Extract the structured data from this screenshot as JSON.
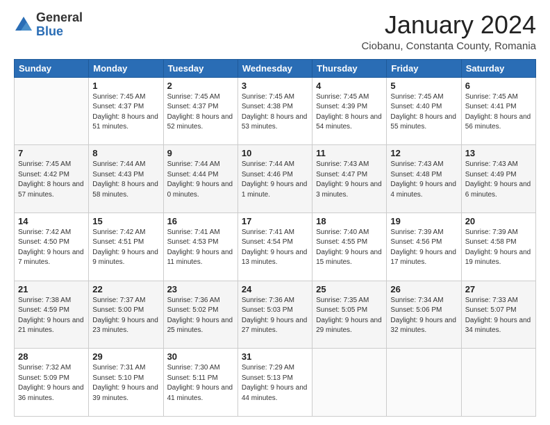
{
  "header": {
    "logo_general": "General",
    "logo_blue": "Blue",
    "month_title": "January 2024",
    "location": "Ciobanu, Constanta County, Romania"
  },
  "days_of_week": [
    "Sunday",
    "Monday",
    "Tuesday",
    "Wednesday",
    "Thursday",
    "Friday",
    "Saturday"
  ],
  "weeks": [
    [
      {
        "day": "",
        "sunrise": "",
        "sunset": "",
        "daylight": ""
      },
      {
        "day": "1",
        "sunrise": "Sunrise: 7:45 AM",
        "sunset": "Sunset: 4:37 PM",
        "daylight": "Daylight: 8 hours and 51 minutes."
      },
      {
        "day": "2",
        "sunrise": "Sunrise: 7:45 AM",
        "sunset": "Sunset: 4:37 PM",
        "daylight": "Daylight: 8 hours and 52 minutes."
      },
      {
        "day": "3",
        "sunrise": "Sunrise: 7:45 AM",
        "sunset": "Sunset: 4:38 PM",
        "daylight": "Daylight: 8 hours and 53 minutes."
      },
      {
        "day": "4",
        "sunrise": "Sunrise: 7:45 AM",
        "sunset": "Sunset: 4:39 PM",
        "daylight": "Daylight: 8 hours and 54 minutes."
      },
      {
        "day": "5",
        "sunrise": "Sunrise: 7:45 AM",
        "sunset": "Sunset: 4:40 PM",
        "daylight": "Daylight: 8 hours and 55 minutes."
      },
      {
        "day": "6",
        "sunrise": "Sunrise: 7:45 AM",
        "sunset": "Sunset: 4:41 PM",
        "daylight": "Daylight: 8 hours and 56 minutes."
      }
    ],
    [
      {
        "day": "7",
        "sunrise": "Sunrise: 7:45 AM",
        "sunset": "Sunset: 4:42 PM",
        "daylight": "Daylight: 8 hours and 57 minutes."
      },
      {
        "day": "8",
        "sunrise": "Sunrise: 7:44 AM",
        "sunset": "Sunset: 4:43 PM",
        "daylight": "Daylight: 8 hours and 58 minutes."
      },
      {
        "day": "9",
        "sunrise": "Sunrise: 7:44 AM",
        "sunset": "Sunset: 4:44 PM",
        "daylight": "Daylight: 9 hours and 0 minutes."
      },
      {
        "day": "10",
        "sunrise": "Sunrise: 7:44 AM",
        "sunset": "Sunset: 4:46 PM",
        "daylight": "Daylight: 9 hours and 1 minute."
      },
      {
        "day": "11",
        "sunrise": "Sunrise: 7:43 AM",
        "sunset": "Sunset: 4:47 PM",
        "daylight": "Daylight: 9 hours and 3 minutes."
      },
      {
        "day": "12",
        "sunrise": "Sunrise: 7:43 AM",
        "sunset": "Sunset: 4:48 PM",
        "daylight": "Daylight: 9 hours and 4 minutes."
      },
      {
        "day": "13",
        "sunrise": "Sunrise: 7:43 AM",
        "sunset": "Sunset: 4:49 PM",
        "daylight": "Daylight: 9 hours and 6 minutes."
      }
    ],
    [
      {
        "day": "14",
        "sunrise": "Sunrise: 7:42 AM",
        "sunset": "Sunset: 4:50 PM",
        "daylight": "Daylight: 9 hours and 7 minutes."
      },
      {
        "day": "15",
        "sunrise": "Sunrise: 7:42 AM",
        "sunset": "Sunset: 4:51 PM",
        "daylight": "Daylight: 9 hours and 9 minutes."
      },
      {
        "day": "16",
        "sunrise": "Sunrise: 7:41 AM",
        "sunset": "Sunset: 4:53 PM",
        "daylight": "Daylight: 9 hours and 11 minutes."
      },
      {
        "day": "17",
        "sunrise": "Sunrise: 7:41 AM",
        "sunset": "Sunset: 4:54 PM",
        "daylight": "Daylight: 9 hours and 13 minutes."
      },
      {
        "day": "18",
        "sunrise": "Sunrise: 7:40 AM",
        "sunset": "Sunset: 4:55 PM",
        "daylight": "Daylight: 9 hours and 15 minutes."
      },
      {
        "day": "19",
        "sunrise": "Sunrise: 7:39 AM",
        "sunset": "Sunset: 4:56 PM",
        "daylight": "Daylight: 9 hours and 17 minutes."
      },
      {
        "day": "20",
        "sunrise": "Sunrise: 7:39 AM",
        "sunset": "Sunset: 4:58 PM",
        "daylight": "Daylight: 9 hours and 19 minutes."
      }
    ],
    [
      {
        "day": "21",
        "sunrise": "Sunrise: 7:38 AM",
        "sunset": "Sunset: 4:59 PM",
        "daylight": "Daylight: 9 hours and 21 minutes."
      },
      {
        "day": "22",
        "sunrise": "Sunrise: 7:37 AM",
        "sunset": "Sunset: 5:00 PM",
        "daylight": "Daylight: 9 hours and 23 minutes."
      },
      {
        "day": "23",
        "sunrise": "Sunrise: 7:36 AM",
        "sunset": "Sunset: 5:02 PM",
        "daylight": "Daylight: 9 hours and 25 minutes."
      },
      {
        "day": "24",
        "sunrise": "Sunrise: 7:36 AM",
        "sunset": "Sunset: 5:03 PM",
        "daylight": "Daylight: 9 hours and 27 minutes."
      },
      {
        "day": "25",
        "sunrise": "Sunrise: 7:35 AM",
        "sunset": "Sunset: 5:05 PM",
        "daylight": "Daylight: 9 hours and 29 minutes."
      },
      {
        "day": "26",
        "sunrise": "Sunrise: 7:34 AM",
        "sunset": "Sunset: 5:06 PM",
        "daylight": "Daylight: 9 hours and 32 minutes."
      },
      {
        "day": "27",
        "sunrise": "Sunrise: 7:33 AM",
        "sunset": "Sunset: 5:07 PM",
        "daylight": "Daylight: 9 hours and 34 minutes."
      }
    ],
    [
      {
        "day": "28",
        "sunrise": "Sunrise: 7:32 AM",
        "sunset": "Sunset: 5:09 PM",
        "daylight": "Daylight: 9 hours and 36 minutes."
      },
      {
        "day": "29",
        "sunrise": "Sunrise: 7:31 AM",
        "sunset": "Sunset: 5:10 PM",
        "daylight": "Daylight: 9 hours and 39 minutes."
      },
      {
        "day": "30",
        "sunrise": "Sunrise: 7:30 AM",
        "sunset": "Sunset: 5:11 PM",
        "daylight": "Daylight: 9 hours and 41 minutes."
      },
      {
        "day": "31",
        "sunrise": "Sunrise: 7:29 AM",
        "sunset": "Sunset: 5:13 PM",
        "daylight": "Daylight: 9 hours and 44 minutes."
      },
      {
        "day": "",
        "sunrise": "",
        "sunset": "",
        "daylight": ""
      },
      {
        "day": "",
        "sunrise": "",
        "sunset": "",
        "daylight": ""
      },
      {
        "day": "",
        "sunrise": "",
        "sunset": "",
        "daylight": ""
      }
    ]
  ]
}
